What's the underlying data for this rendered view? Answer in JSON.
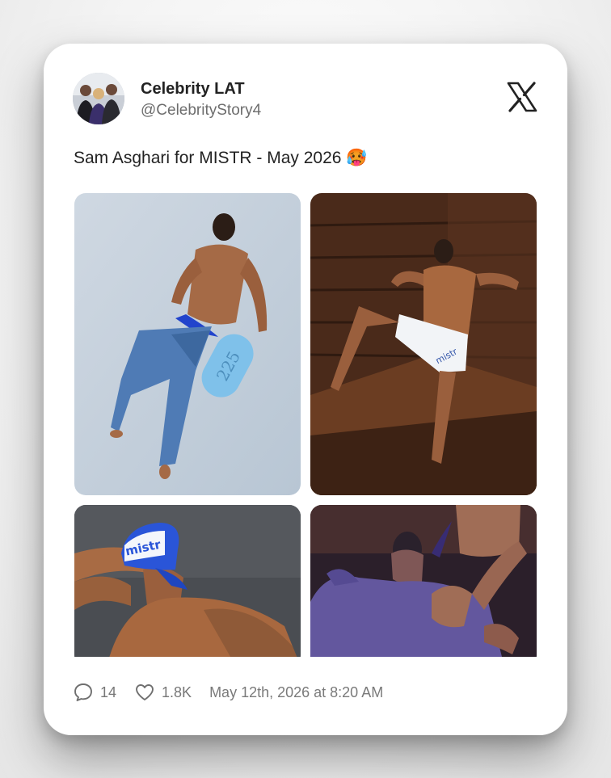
{
  "author": {
    "display_name": "Celebrity LAT",
    "handle": "@CelebrityStory4"
  },
  "tweet": {
    "text": "Sam Asghari for MISTR - May 2026 🥵"
  },
  "media": {
    "images": [
      {
        "name": "photo-1",
        "brand_text": "225"
      },
      {
        "name": "photo-2",
        "brand_text": "mistr"
      },
      {
        "name": "photo-3",
        "brand_text": "mistr"
      },
      {
        "name": "photo-4"
      }
    ]
  },
  "footer": {
    "reply_count": "14",
    "like_count": "1.8K",
    "timestamp": "May 12th, 2026 at 8:20 AM"
  },
  "icons": {
    "brand": "x-logo-icon",
    "reply": "speech-bubble-icon",
    "like": "heart-icon"
  },
  "colors": {
    "card": "#ffffff",
    "text": "#222222",
    "muted": "#777777"
  }
}
